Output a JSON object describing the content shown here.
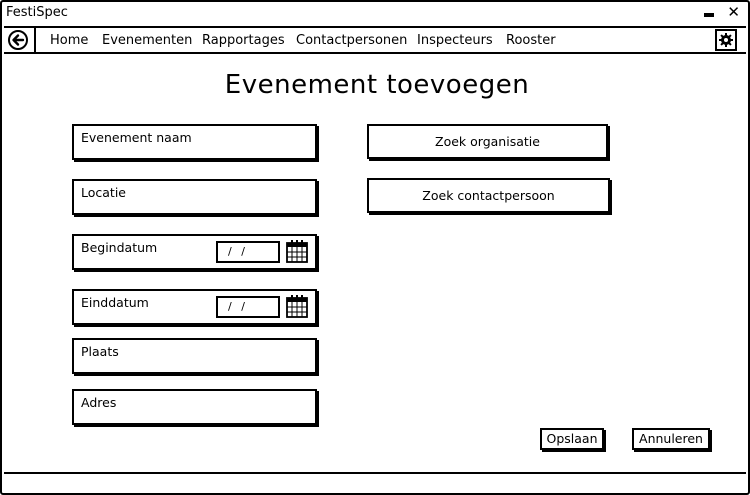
{
  "window": {
    "title": "FestiSpec"
  },
  "nav": {
    "items": [
      {
        "label": "Home"
      },
      {
        "label": "Evenementen"
      },
      {
        "label": "Rapportages"
      },
      {
        "label": "Contactpersonen"
      },
      {
        "label": "Inspecteurs"
      },
      {
        "label": "Rooster"
      }
    ]
  },
  "page": {
    "title": "Evenement toevoegen"
  },
  "form": {
    "event_name": {
      "label": "Evenement naam"
    },
    "location": {
      "label": "Locatie"
    },
    "start_date": {
      "label": "Begindatum",
      "value": "/ /"
    },
    "end_date": {
      "label": "Einddatum",
      "value": "/ /"
    },
    "city": {
      "label": "Plaats"
    },
    "address": {
      "label": "Adres"
    }
  },
  "actions": {
    "find_organization": "Zoek organisatie",
    "find_contact": "Zoek contactpersoon",
    "save": "Opslaan",
    "cancel": "Annuleren"
  },
  "icons": {
    "back": "back-arrow-icon",
    "settings": "gear-icon",
    "calendar": "calendar-icon",
    "minimize": "minimize-icon",
    "close": "close-icon"
  }
}
